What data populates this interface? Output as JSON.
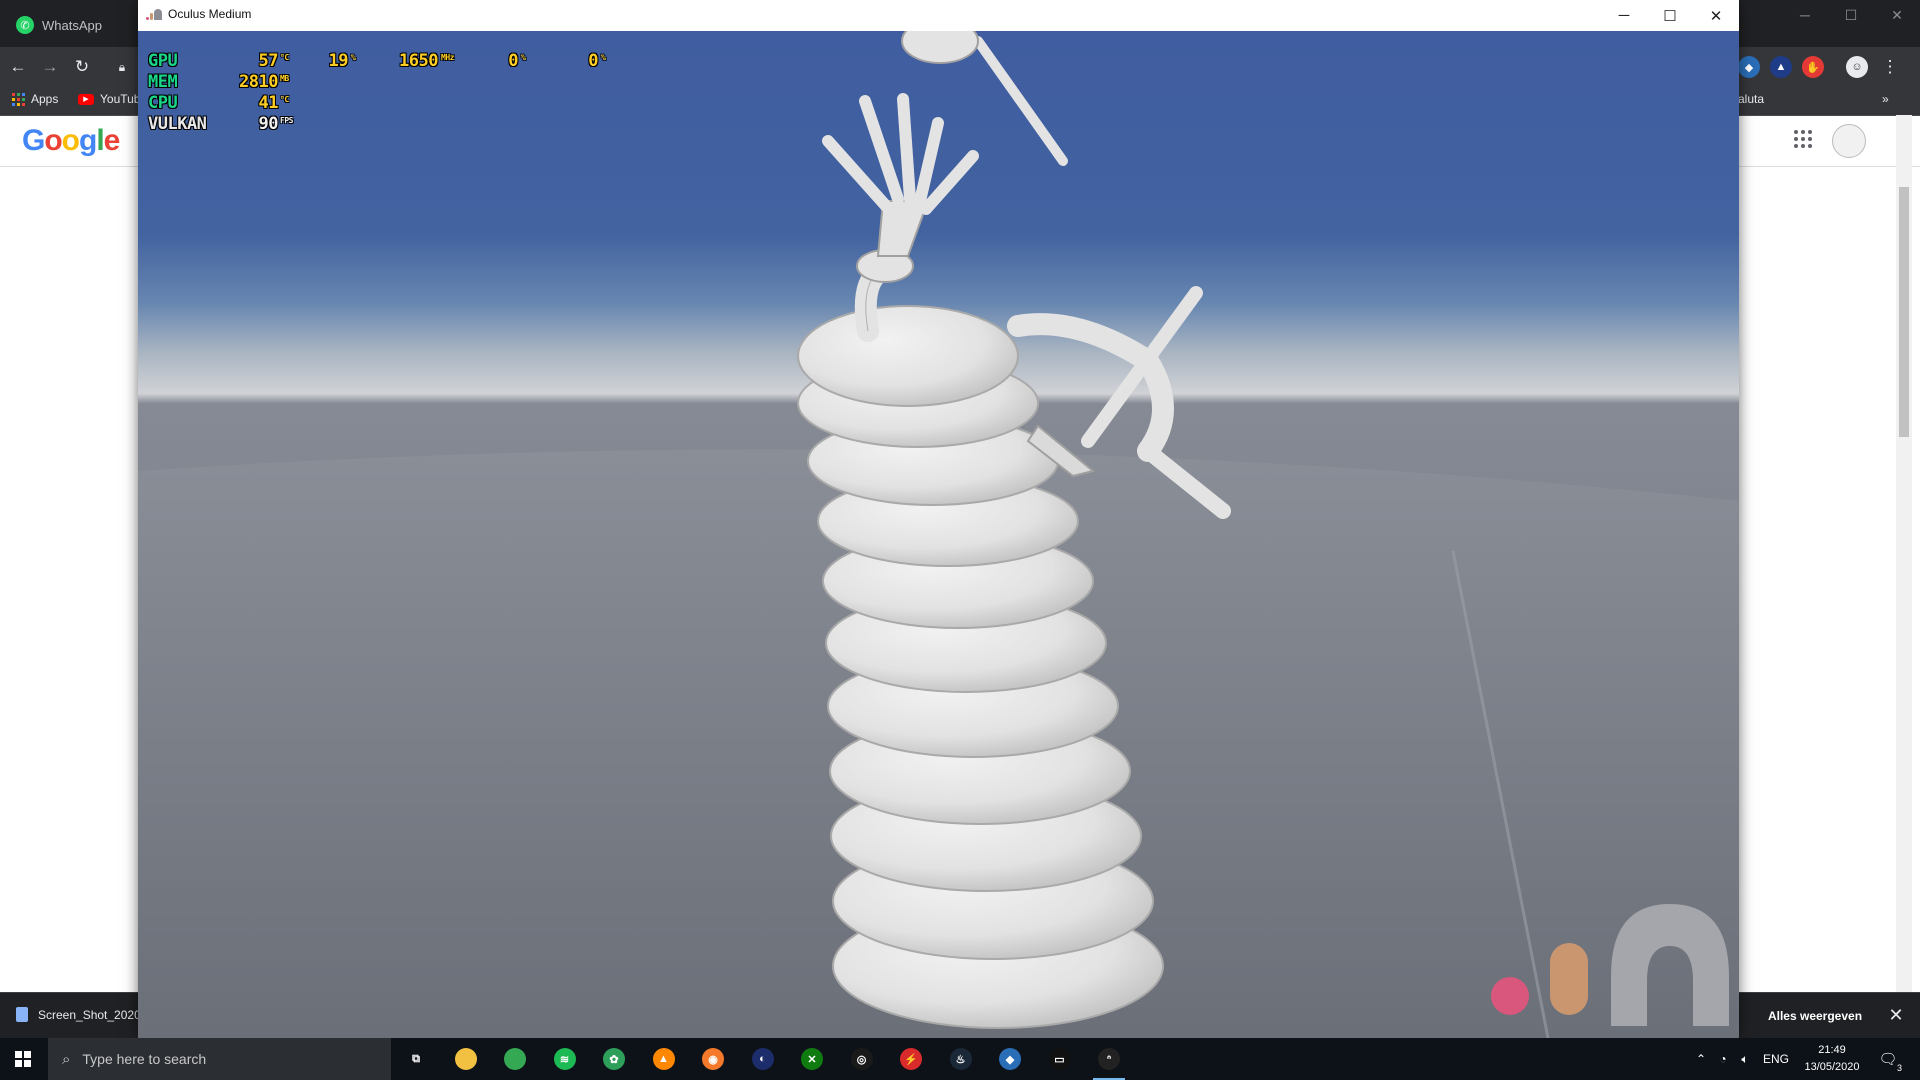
{
  "chrome": {
    "tab_title": "WhatsApp",
    "bookmarks": [
      {
        "label": "Apps"
      },
      {
        "label": "YouTube"
      }
    ],
    "bookmark_right": "aluta",
    "overflow": "»",
    "google_logo": [
      "G",
      "o",
      "o",
      "g",
      "l",
      "e"
    ],
    "google_colors": [
      "#4285f4",
      "#ea4335",
      "#fbbc05",
      "#4285f4",
      "#34a853",
      "#ea4335"
    ],
    "download_item": "Screen_Shot_2020",
    "show_all": "Alles weergeven",
    "close": "✕"
  },
  "medium_window": {
    "title": "Oculus Medium",
    "minimize": "─",
    "maximize": "☐",
    "close": "✕",
    "logo_colors": [
      "#d9577d",
      "#c99670",
      "#a5a5ac"
    ]
  },
  "osd": {
    "rows": [
      {
        "label": "GPU",
        "value": "57",
        "unit": "°C"
      },
      {
        "label": "MEM",
        "value": "2810",
        "unit": "MB"
      },
      {
        "label": "CPU",
        "value": "41",
        "unit": "°C"
      },
      {
        "label": "VULKAN",
        "value": "90",
        "unit": "FPS"
      }
    ],
    "extra": [
      {
        "value": "19",
        "unit": "%"
      },
      {
        "value": "1650",
        "unit": "MHz"
      },
      {
        "value": "0",
        "unit": "%"
      },
      {
        "value": "0",
        "unit": "%"
      }
    ]
  },
  "taskbar": {
    "search_placeholder": "Type here to search",
    "apps": [
      {
        "name": "task-view",
        "color": "#0d1218",
        "glyph": "⧉"
      },
      {
        "name": "file-explorer",
        "color": "#f2c142",
        "glyph": ""
      },
      {
        "name": "chrome",
        "color": "#34a853",
        "glyph": ""
      },
      {
        "name": "spotify",
        "color": "#1db954",
        "glyph": "≋"
      },
      {
        "name": "app-green",
        "color": "#2e9e5b",
        "glyph": "✿"
      },
      {
        "name": "vlc",
        "color": "#ff8800",
        "glyph": "▲"
      },
      {
        "name": "blender",
        "color": "#f5792a",
        "glyph": "◉"
      },
      {
        "name": "cinema4d",
        "color": "#1d2c6b",
        "glyph": "◐"
      },
      {
        "name": "xbox",
        "color": "#107c10",
        "glyph": "✕"
      },
      {
        "name": "amd",
        "color": "#1a1a1a",
        "glyph": "◎"
      },
      {
        "name": "power-app",
        "color": "#d92b2b",
        "glyph": "⚡"
      },
      {
        "name": "steam",
        "color": "#1b2838",
        "glyph": "♨"
      },
      {
        "name": "app-blue",
        "color": "#2a6eb8",
        "glyph": "◆"
      },
      {
        "name": "oculus",
        "color": "#111",
        "glyph": "▭"
      },
      {
        "name": "medium",
        "color": "#222",
        "glyph": "ᐢ"
      }
    ],
    "language": "ENG",
    "time": "21:49",
    "date": "13/05/2020",
    "notification_count": "3"
  }
}
